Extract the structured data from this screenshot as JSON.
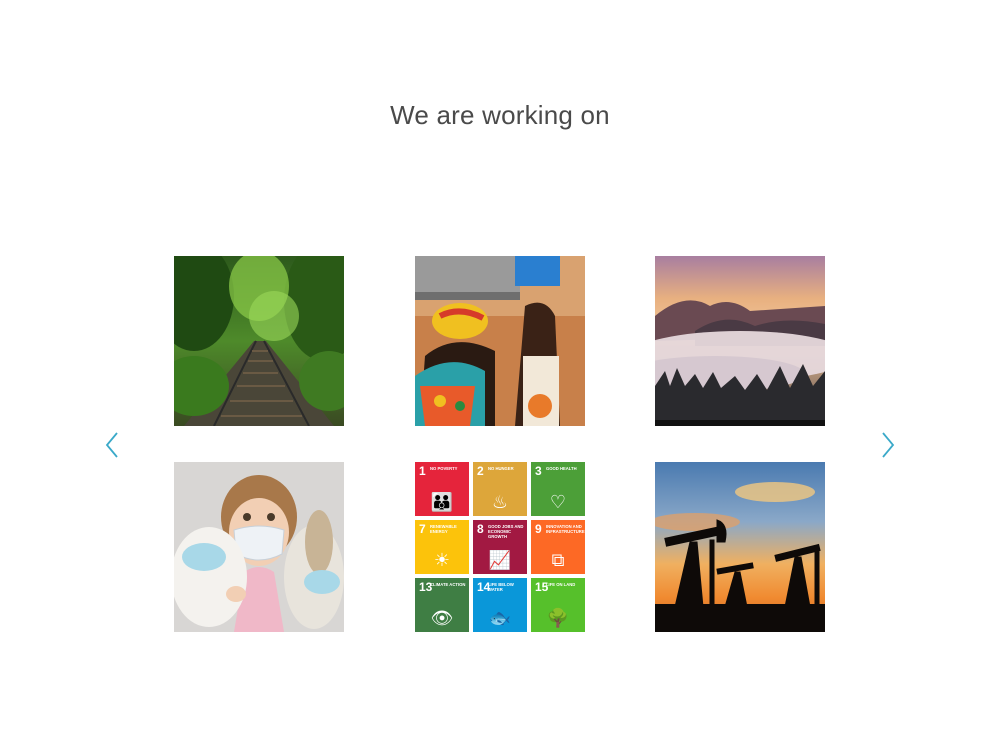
{
  "heading": "We are working on",
  "colors": {
    "heading": "#4a4a4a",
    "arrow": "#3aa9c9"
  },
  "carousel": {
    "prev_icon": "chevron-left-icon",
    "next_icon": "chevron-right-icon"
  },
  "tiles": [
    {
      "subject": "railway-track-forest"
    },
    {
      "subject": "women-carrying-water"
    },
    {
      "subject": "misty-mountains-sunset"
    },
    {
      "subject": "child-with-face-mask"
    },
    {
      "subject": "sdg-goals-grid"
    },
    {
      "subject": "oil-pumps-sunset"
    }
  ],
  "sdg": [
    {
      "num": "1",
      "label": "No poverty",
      "color": "#e5243b",
      "glyph": "👪"
    },
    {
      "num": "2",
      "label": "No hunger",
      "color": "#dda63a",
      "glyph": "♨"
    },
    {
      "num": "3",
      "label": "Good health",
      "color": "#4c9f38",
      "glyph": "♡"
    },
    {
      "num": "7",
      "label": "Renewable energy",
      "color": "#fcc30b",
      "glyph": "☀"
    },
    {
      "num": "8",
      "label": "Good jobs and economic growth",
      "color": "#a21942",
      "glyph": "📈"
    },
    {
      "num": "9",
      "label": "Innovation and infrastructure",
      "color": "#fd6925",
      "glyph": "⧉"
    },
    {
      "num": "13",
      "label": "Climate action",
      "color": "#3f7e44",
      "glyph": "👁"
    },
    {
      "num": "14",
      "label": "Life below water",
      "color": "#0a97d9",
      "glyph": "🐟"
    },
    {
      "num": "15",
      "label": "Life on land",
      "color": "#56c02b",
      "glyph": "🌳"
    }
  ]
}
